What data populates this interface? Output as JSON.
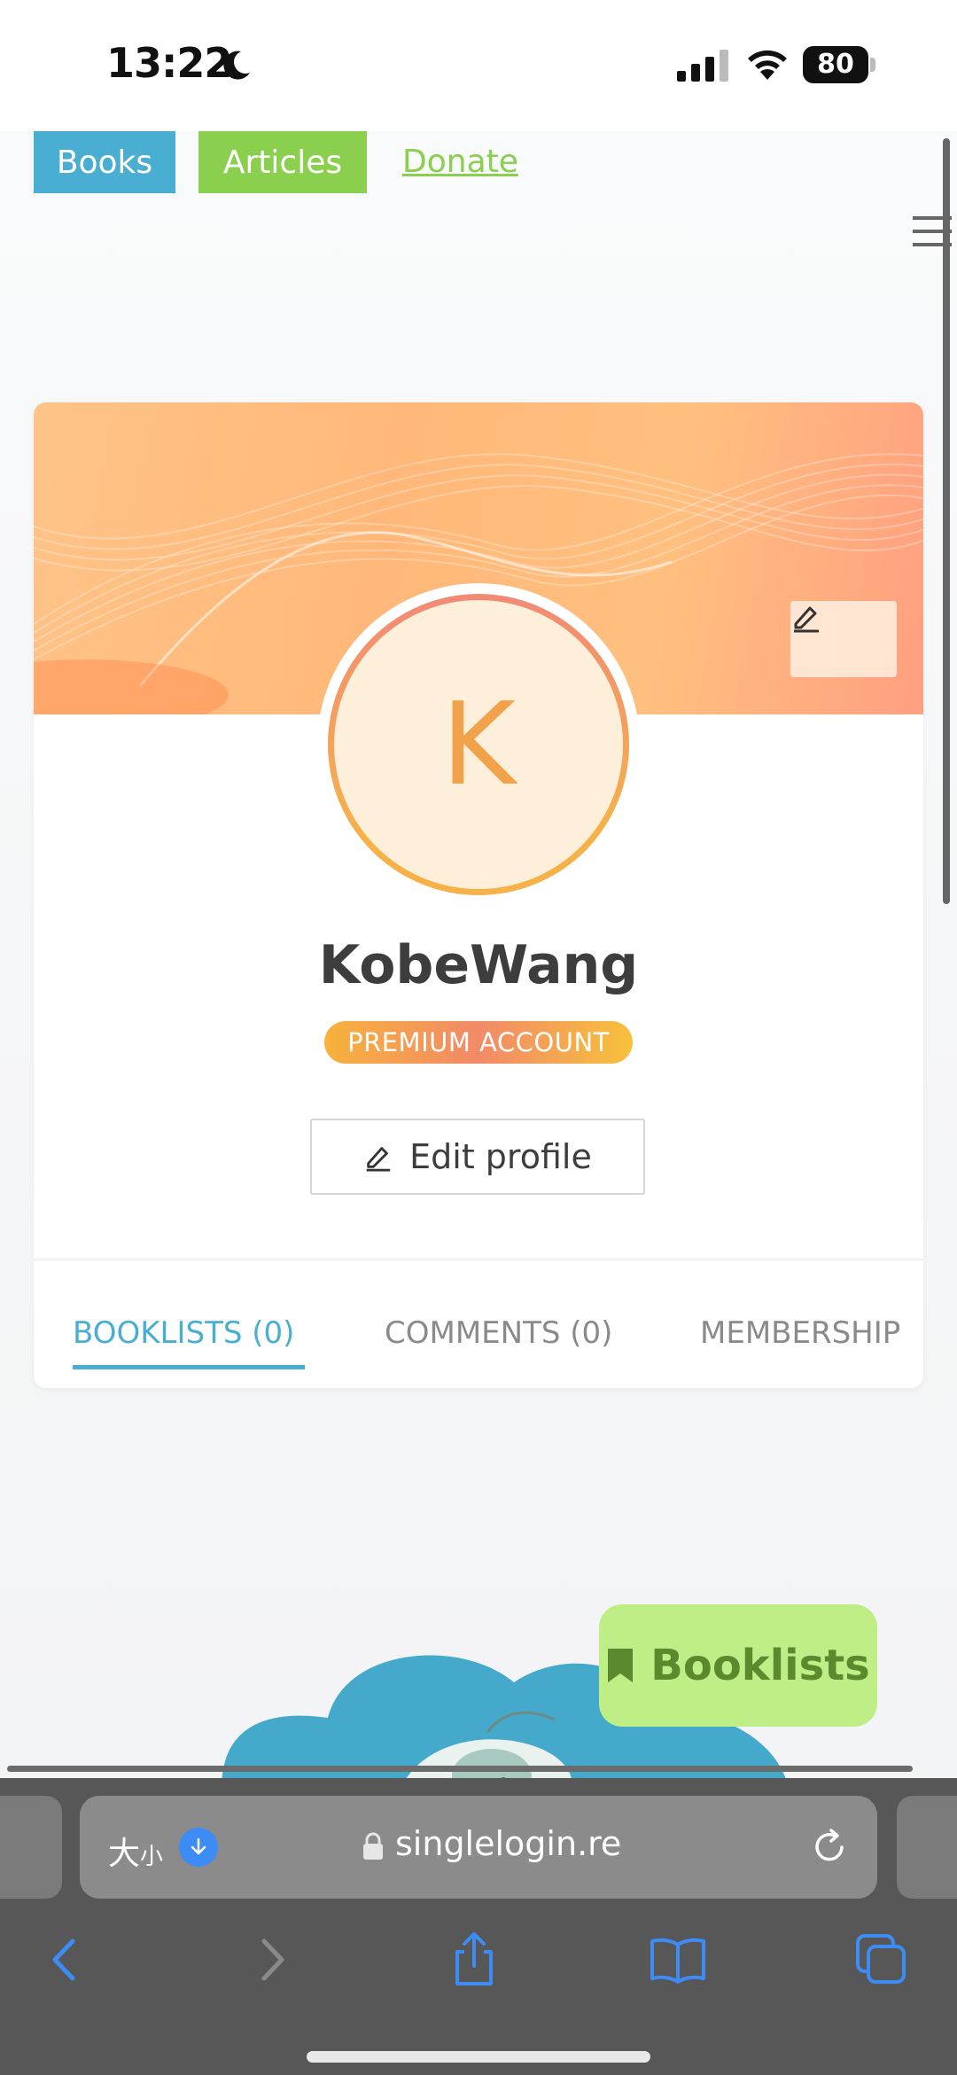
{
  "status_bar": {
    "time": "13:22",
    "battery": "80",
    "icons": [
      "moon-icon",
      "signal-icon",
      "wifi-icon",
      "battery-icon"
    ]
  },
  "nav": {
    "books": "Books",
    "articles": "Articles",
    "donate": "Donate"
  },
  "profile": {
    "avatar_letter": "K",
    "username": "KobeWang",
    "badge": "PREMIUM ACCOUNT",
    "edit_profile": "Edit profile"
  },
  "tabs": [
    {
      "label": "BOOKLISTS (0)",
      "active": true
    },
    {
      "label": "COMMENTS (0)",
      "active": false
    },
    {
      "label": "MEMBERSHIP",
      "active": false
    }
  ],
  "illustration": {
    "bubble_label": "Booklists"
  },
  "browser": {
    "aa_big": "大",
    "aa_small": "小",
    "url": "singlelogin.re"
  },
  "colors": {
    "accent_blue": "#49aed1",
    "accent_green": "#8bcf4e",
    "avatar_text": "#f2a24a",
    "premium_gradient": [
      "#f7b23b",
      "#f28a68",
      "#f7c13b"
    ]
  }
}
